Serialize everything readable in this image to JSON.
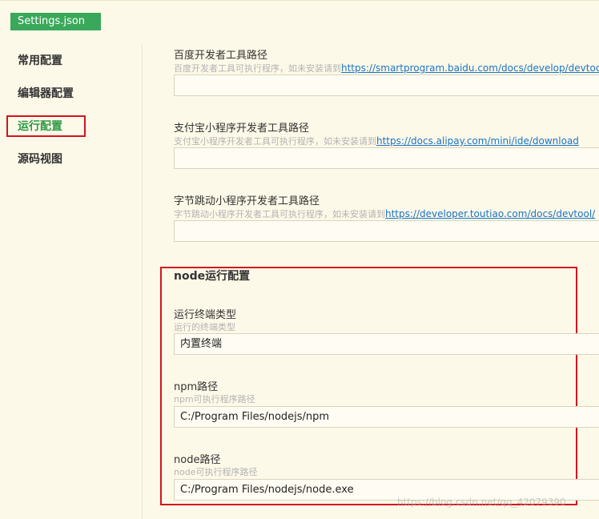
{
  "tab": {
    "title": "Settings.json"
  },
  "sidebar": {
    "items": [
      {
        "label": "常用配置"
      },
      {
        "label": "编辑器配置"
      },
      {
        "label": "运行配置"
      },
      {
        "label": "源码视图"
      }
    ]
  },
  "settings": {
    "baidu": {
      "label": "百度开发者工具路径",
      "desc": "百度开发者工具可执行程序，如未安装请到",
      "link": "https://smartprogram.baidu.com/docs/develop/devtools/",
      "value": ""
    },
    "alipay": {
      "label": "支付宝小程序开发者工具路径",
      "desc": "支付宝小程序开发者工具可执行程序，如未安装请到",
      "link": "https://docs.alipay.com/mini/ide/download",
      "value": ""
    },
    "toutiao": {
      "label": "字节跳动小程序开发者工具路径",
      "desc": "字节跳动小程序开发者工具可执行程序，如未安装请到",
      "link": "https://developer.toutiao.com/docs/devtool/",
      "value": ""
    }
  },
  "node_section": {
    "title": "node运行配置",
    "terminal": {
      "label": "运行终端类型",
      "desc": "运行的终端类型",
      "value": "内置终端"
    },
    "npm": {
      "label": "npm路径",
      "desc": "npm可执行程序路径",
      "value": "C:/Program Files/nodejs/npm"
    },
    "node": {
      "label": "node路径",
      "desc": "node可执行程序路径",
      "value": "C:/Program Files/nodejs/node.exe"
    }
  },
  "watermark": "https://blog.csdn.net/qq_42079390",
  "colors": {
    "accent": "#3aa85a",
    "highlight": "#d3141f",
    "link": "#1a73c8"
  }
}
